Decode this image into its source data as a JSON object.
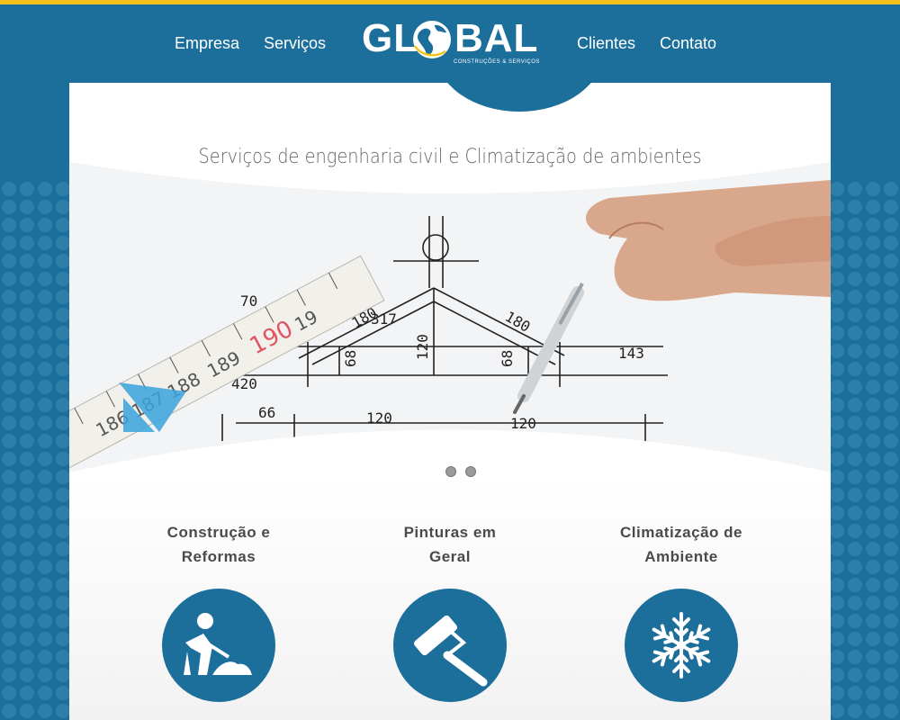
{
  "nav": {
    "left": [
      "Empresa",
      "Serviços"
    ],
    "right": [
      "Clientes",
      "Contato"
    ]
  },
  "logo": {
    "wordmark_left": "GL",
    "wordmark_right": "BAL",
    "subtitle": "CONSTRUÇÕES & SERVIÇOS"
  },
  "hero": {
    "tagline": "Serviços de engenharia civil e Climatização de ambientes",
    "ruler_marks": [
      "190",
      "189",
      "188",
      "187",
      "186",
      "19"
    ],
    "drawing_labels": [
      "317",
      "70",
      "180",
      "180",
      "143",
      "143",
      "120",
      "68",
      "68",
      "420",
      "66",
      "120",
      "120"
    ]
  },
  "services": [
    {
      "title_line1": "Construção e",
      "title_line2": "Reformas",
      "icon": "construction-worker-icon"
    },
    {
      "title_line1": "Pinturas em",
      "title_line2": "Geral",
      "icon": "paint-roller-icon"
    },
    {
      "title_line1": "Climatização de",
      "title_line2": "Ambiente",
      "icon": "snowflake-icon"
    }
  ],
  "colors": {
    "accent": "#1c6f9b",
    "topline": "#f3c21b"
  }
}
